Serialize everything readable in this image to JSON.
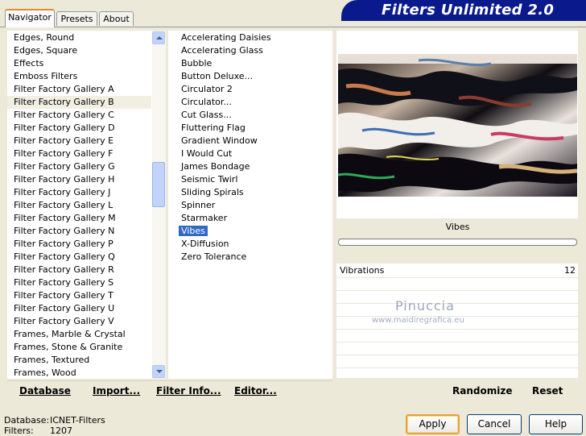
{
  "tabs": [
    "Navigator",
    "Presets",
    "About"
  ],
  "banner": "Filters Unlimited 2.0",
  "categories": [
    "Edges, Round",
    "Edges, Square",
    "Effects",
    "Emboss Filters",
    "Filter Factory Gallery A",
    "Filter Factory Gallery B",
    "Filter Factory Gallery C",
    "Filter Factory Gallery D",
    "Filter Factory Gallery E",
    "Filter Factory Gallery F",
    "Filter Factory Gallery G",
    "Filter Factory Gallery H",
    "Filter Factory Gallery J",
    "Filter Factory Gallery L",
    "Filter Factory Gallery M",
    "Filter Factory Gallery N",
    "Filter Factory Gallery P",
    "Filter Factory Gallery Q",
    "Filter Factory Gallery R",
    "Filter Factory Gallery S",
    "Filter Factory Gallery T",
    "Filter Factory Gallery U",
    "Filter Factory Gallery V",
    "Frames, Marble & Crystal",
    "Frames, Stone & Granite",
    "Frames, Textured",
    "Frames, Wood"
  ],
  "selected_category": "Filter Factory Gallery B",
  "filters": [
    "Accelerating Daisies",
    "Accelerating Glass",
    "Bubble",
    "Button Deluxe...",
    "Circulator 2",
    "Circulator...",
    "Cut Glass...",
    "Fluttering Flag",
    "Gradient Window",
    "I Would Cut",
    "James Bondage",
    "Seismic Twirl",
    "Sliding Spirals",
    "Spinner",
    "Starmaker",
    "Vibes",
    "X-Diffusion",
    "Zero Tolerance"
  ],
  "selected_filter": "Vibes",
  "preview": {
    "filter_name": "Vibes",
    "progress": 0
  },
  "params": [
    {
      "label": "Vibrations",
      "value": "12"
    }
  ],
  "watermark": {
    "name": "Pinuccia",
    "url": "www.maidiregrafica.eu"
  },
  "toolbar": {
    "database": "Database",
    "import": "Import...",
    "filter_info": "Filter Info...",
    "editor": "Editor...",
    "randomize": "Randomize",
    "reset": "Reset"
  },
  "status": {
    "database_label": "Database:",
    "database_value": "ICNET-Filters",
    "filters_label": "Filters:",
    "filters_value": "1207"
  },
  "buttons": {
    "apply": "Apply",
    "cancel": "Cancel",
    "help": "Help"
  },
  "colors": {
    "banner": "#0A1A8C",
    "selection": "#316AC5",
    "active_tab": "#E68B2C"
  }
}
